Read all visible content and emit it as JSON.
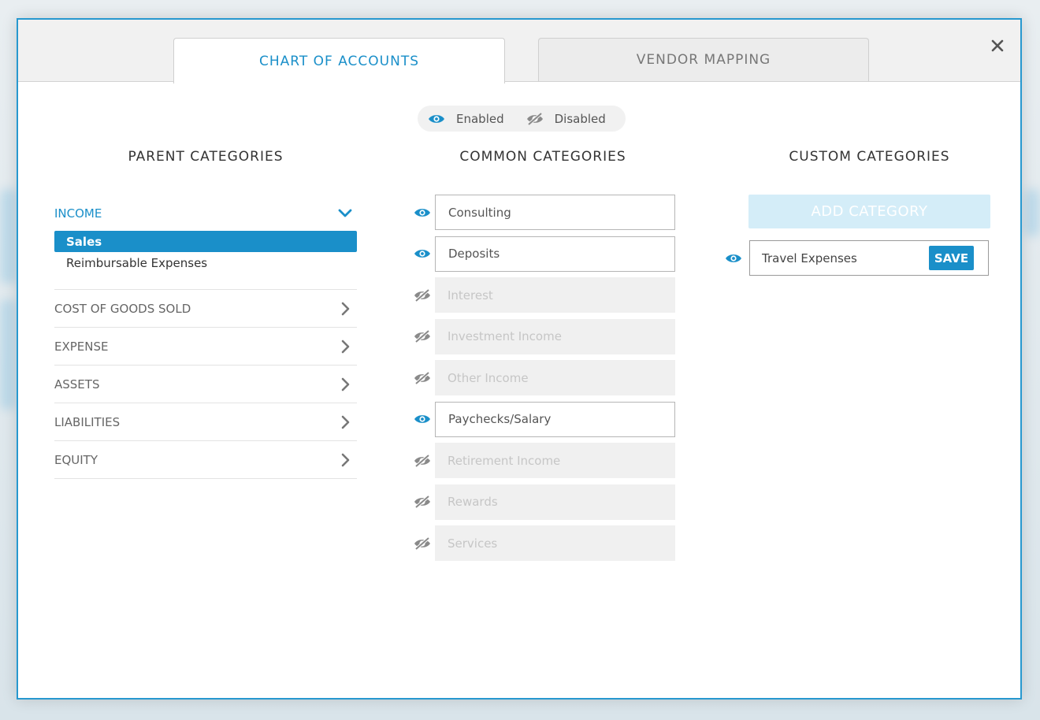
{
  "tabs": [
    {
      "label": "CHART OF ACCOUNTS",
      "active": true
    },
    {
      "label": "VENDOR MAPPING",
      "active": false
    }
  ],
  "legend": {
    "enabled_label": "Enabled",
    "disabled_label": "Disabled"
  },
  "columns": {
    "parent": "PARENT CATEGORIES",
    "common": "COMMON CATEGORIES",
    "custom": "CUSTOM CATEGORIES"
  },
  "parent_categories": {
    "expanded": {
      "label": "INCOME",
      "subcategories": [
        {
          "label": "Sales",
          "selected": true
        },
        {
          "label": "Reimbursable Expenses",
          "selected": false
        }
      ]
    },
    "collapsed": [
      {
        "label": "COST OF GOODS SOLD"
      },
      {
        "label": "EXPENSE"
      },
      {
        "label": "ASSETS"
      },
      {
        "label": "LIABILITIES"
      },
      {
        "label": "EQUITY"
      }
    ]
  },
  "common_categories": [
    {
      "label": "Consulting",
      "enabled": true
    },
    {
      "label": "Deposits",
      "enabled": true
    },
    {
      "label": "Interest",
      "enabled": false
    },
    {
      "label": "Investment Income",
      "enabled": false
    },
    {
      "label": "Other Income",
      "enabled": false
    },
    {
      "label": "Paychecks/Salary",
      "enabled": true
    },
    {
      "label": "Retirement Income",
      "enabled": false
    },
    {
      "label": "Rewards",
      "enabled": false
    },
    {
      "label": "Services",
      "enabled": false
    }
  ],
  "custom": {
    "add_label": "ADD CATEGORY",
    "new_category_value": "Travel Expenses",
    "save_label": "SAVE"
  },
  "colors": {
    "accent": "#1a8fc9",
    "disabled_icon": "#8a8a8a",
    "border": "#2798cf"
  }
}
